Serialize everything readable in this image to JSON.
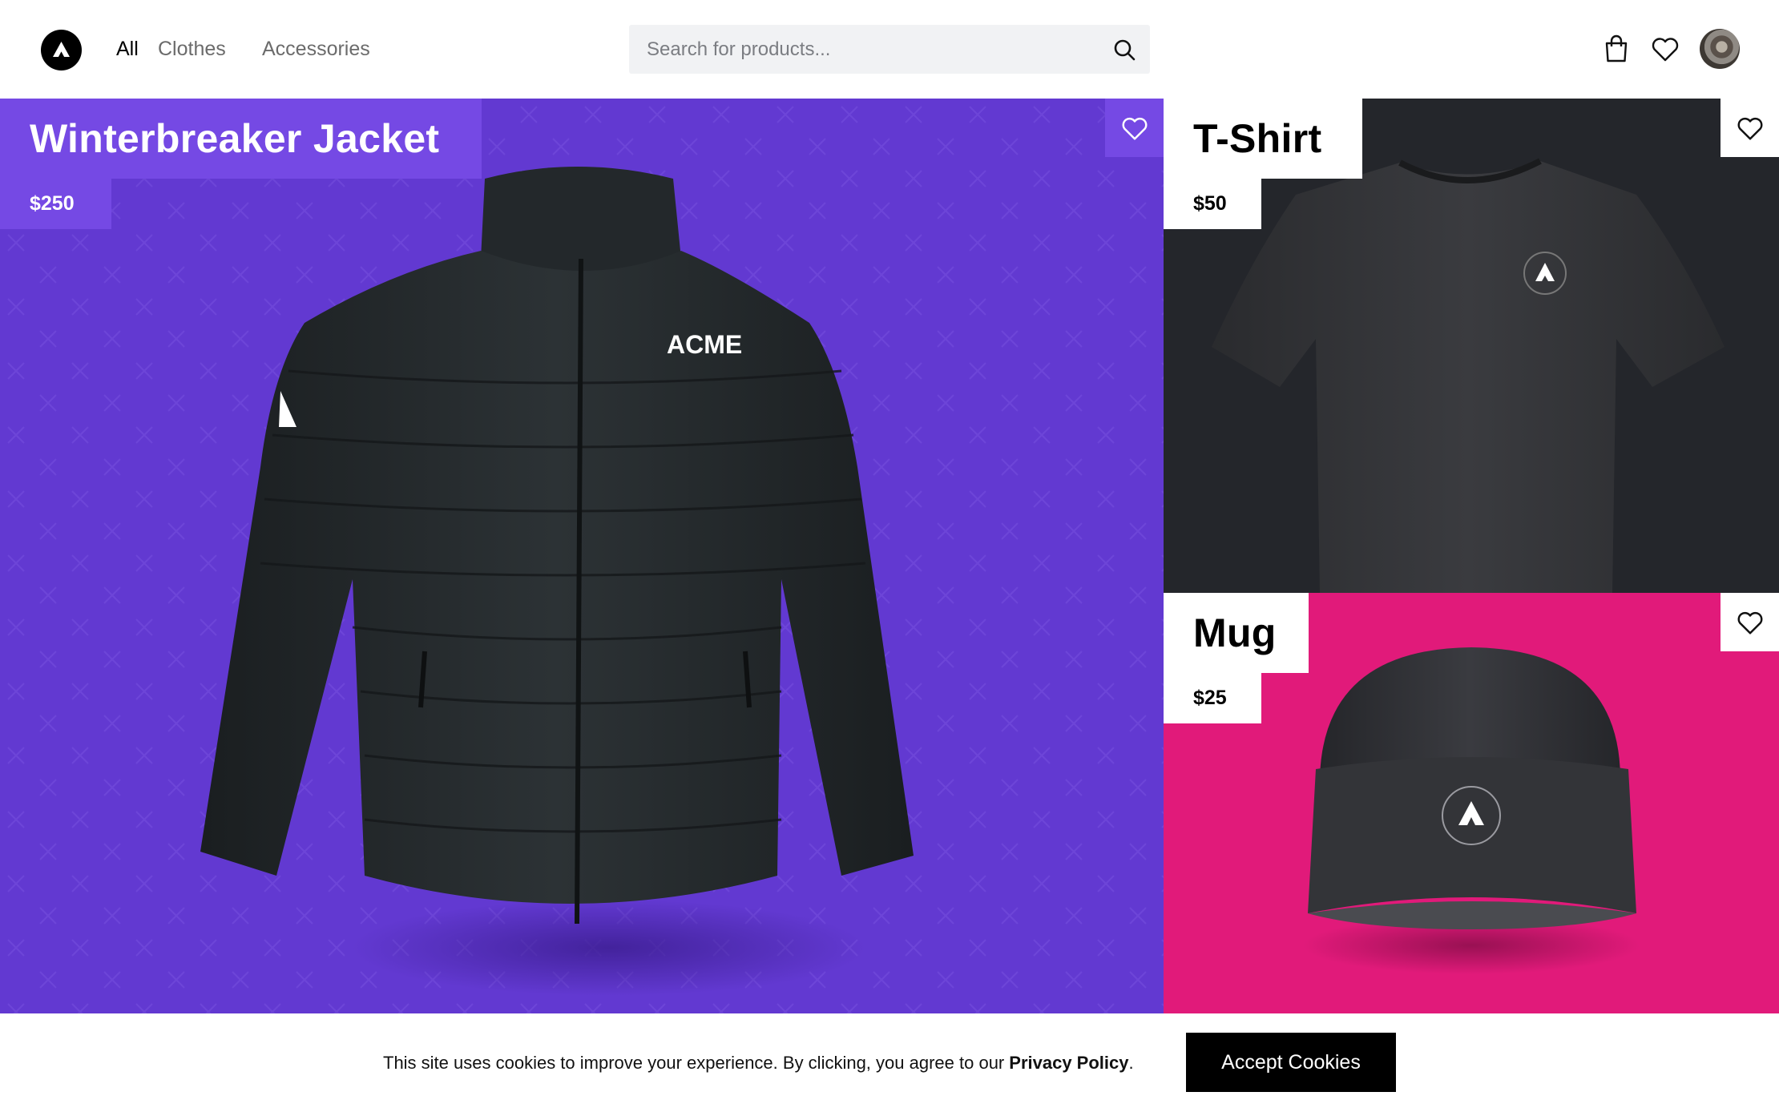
{
  "header": {
    "nav": [
      {
        "label": "All",
        "active": true
      },
      {
        "label": "Clothes",
        "active": false
      },
      {
        "label": "Accessories",
        "active": false
      }
    ],
    "search": {
      "placeholder": "Search for products...",
      "value": ""
    },
    "icons": [
      "logo-icon",
      "search-icon",
      "cart-icon",
      "heart-icon",
      "avatar"
    ]
  },
  "products": [
    {
      "title": "Winterbreaker Jacket",
      "price": "$250",
      "background": "#6239d1",
      "print": "ACME"
    },
    {
      "title": "T-Shirt",
      "price": "$50",
      "background": "#24262b"
    },
    {
      "title": "Mug",
      "price": "$25",
      "background": "#e11a7a"
    }
  ],
  "cookie": {
    "text": "This site uses cookies to improve your experience. By clicking, you agree to our",
    "link": "Privacy Policy",
    "period": ".",
    "button": "Accept Cookies"
  },
  "colors": {
    "accent": "#7549e4",
    "pink": "#e11a7a",
    "dark": "#24262b"
  }
}
